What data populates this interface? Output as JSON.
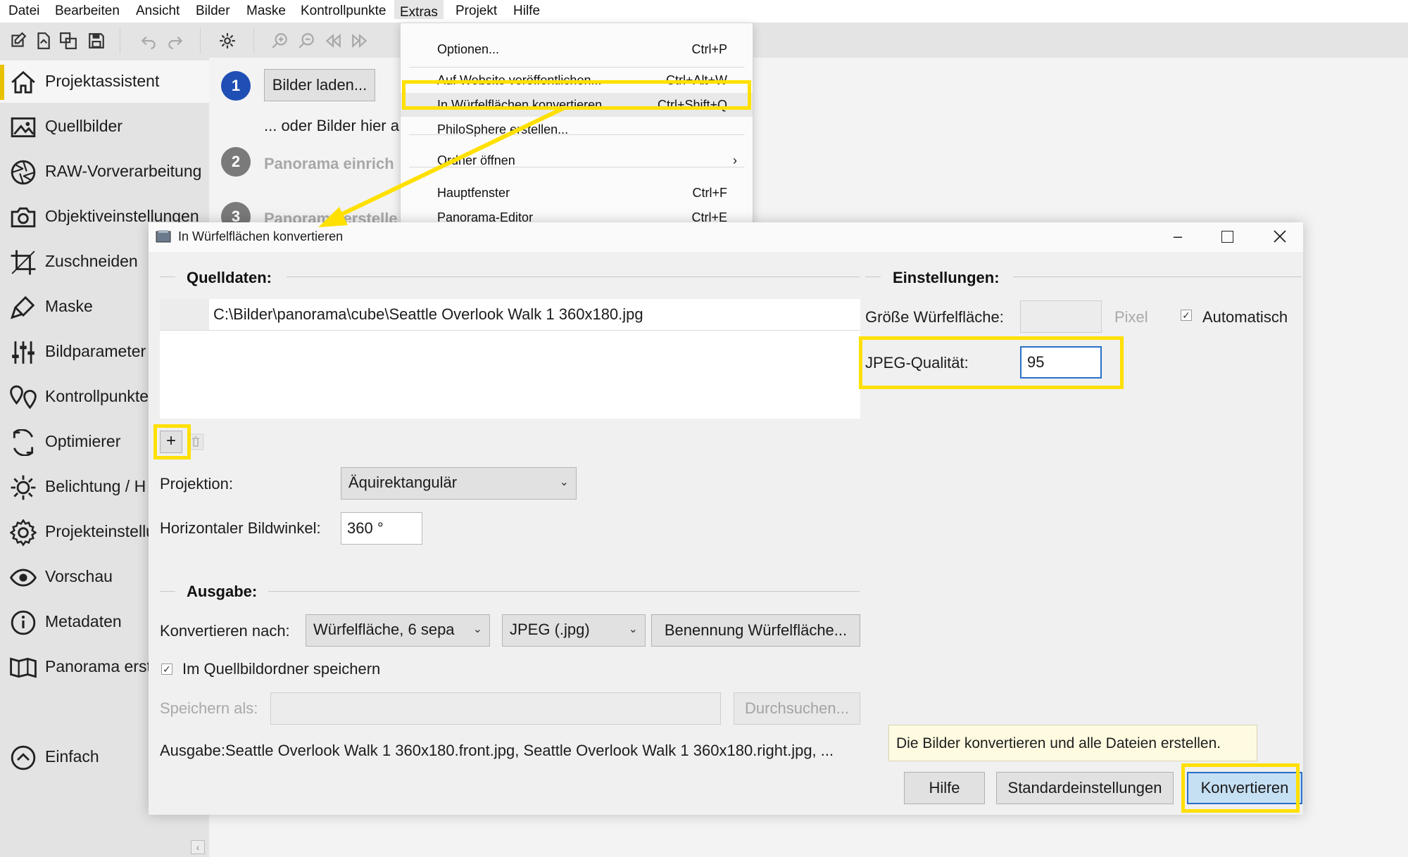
{
  "menubar": {
    "items": [
      "Datei",
      "Bearbeiten",
      "Ansicht",
      "Bilder",
      "Maske",
      "Kontrollpunkte",
      "Extras",
      "Projekt",
      "Hilfe"
    ]
  },
  "toolbar": {
    "icons": [
      "new-project-icon",
      "open-icon",
      "copy-icon",
      "save-icon",
      "undo-icon",
      "redo-icon",
      "settings-icon",
      "zoom-in-icon",
      "zoom-out-icon",
      "first-icon",
      "last-icon"
    ]
  },
  "sidebar": {
    "items": [
      {
        "label": "Projektassistent",
        "icon": "home-icon"
      },
      {
        "label": "Quellbilder",
        "icon": "image-icon"
      },
      {
        "label": "RAW-Vorverarbeitung",
        "icon": "aperture-icon"
      },
      {
        "label": "Objektiveinstellungen",
        "icon": "camera-icon"
      },
      {
        "label": "Zuschneiden",
        "icon": "crop-icon"
      },
      {
        "label": "Maske",
        "icon": "brush-icon"
      },
      {
        "label": "Bildparameter",
        "icon": "sliders-icon"
      },
      {
        "label": "Kontrollpunkte",
        "icon": "pin-icon"
      },
      {
        "label": "Optimierer",
        "icon": "refresh-icon"
      },
      {
        "label": "Belichtung / H",
        "icon": "sun-icon"
      },
      {
        "label": "Projekteinstellu",
        "icon": "gear-icon"
      },
      {
        "label": "Vorschau",
        "icon": "eye-icon"
      },
      {
        "label": "Metadaten",
        "icon": "info-icon"
      },
      {
        "label": "Panorama erst",
        "icon": "panorama-icon"
      }
    ],
    "mode": "Einfach"
  },
  "assistant": {
    "step1_number": "1",
    "load_button": "Bilder laden...",
    "drop_hint": "... oder Bilder hier a",
    "step2_number": "2",
    "step2_label": "Panorama einrich",
    "step3_number": "3",
    "step3_label": "Panorama erstelle"
  },
  "extras_menu": {
    "items": [
      {
        "label": "Optionen...",
        "shortcut": "Ctrl+P"
      },
      {
        "label": "Auf Website veröffentlichen...",
        "shortcut": "Ctrl+Alt+W"
      },
      {
        "label": "In Würfelflächen konvertieren...",
        "shortcut": "Ctrl+Shift+Q"
      },
      {
        "label": "PhiloSphere erstellen...",
        "shortcut": ""
      },
      {
        "label": "Ordner öffnen",
        "shortcut": "›"
      },
      {
        "label": "Hauptfenster",
        "shortcut": "Ctrl+F"
      },
      {
        "label": "Panorama-Editor",
        "shortcut": "Ctrl+E"
      }
    ]
  },
  "dialog": {
    "title": "In Würfelflächen konvertieren",
    "source_group": "Quelldaten:",
    "source_file": "C:\\Bilder\\panorama\\cube\\Seattle Overlook Walk 1 360x180.jpg",
    "add_button": "+",
    "projection_label": "Projektion:",
    "projection_value": "Äquirektangulär",
    "hfov_label": "Horizontaler Bildwinkel:",
    "hfov_value": "360 °",
    "output_group": "Ausgabe:",
    "convert_to_label": "Konvertieren nach:",
    "convert_to_value": "Würfelfläche, 6 sepa",
    "format_value": "JPEG (.jpg)",
    "naming_button": "Benennung Würfelfläche...",
    "save_in_source_label": "Im Quellbildordner speichern",
    "save_as_label": "Speichern als:",
    "browse_button": "Durchsuchen...",
    "output_text": "Ausgabe:Seattle Overlook Walk 1 360x180.front.jpg, Seattle Overlook Walk 1 360x180.right.jpg, ...",
    "settings_group": "Einstellungen:",
    "cube_size_label": "Größe Würfelfläche:",
    "pixel_unit": "Pixel",
    "automatic_label": "Automatisch",
    "jpeg_quality_label": "JPEG-Qualität:",
    "jpeg_quality_value": "95",
    "tooltip": "Die Bilder konvertieren und alle Dateien erstellen.",
    "help_button": "Hilfe",
    "defaults_button": "Standardeinstellungen",
    "convert_button": "Konvertieren"
  },
  "colors": {
    "highlight": "#ffe000",
    "step_active": "#1f4fb5",
    "step_inactive": "#7a7a7a",
    "convert_button": "#c5dff3"
  }
}
